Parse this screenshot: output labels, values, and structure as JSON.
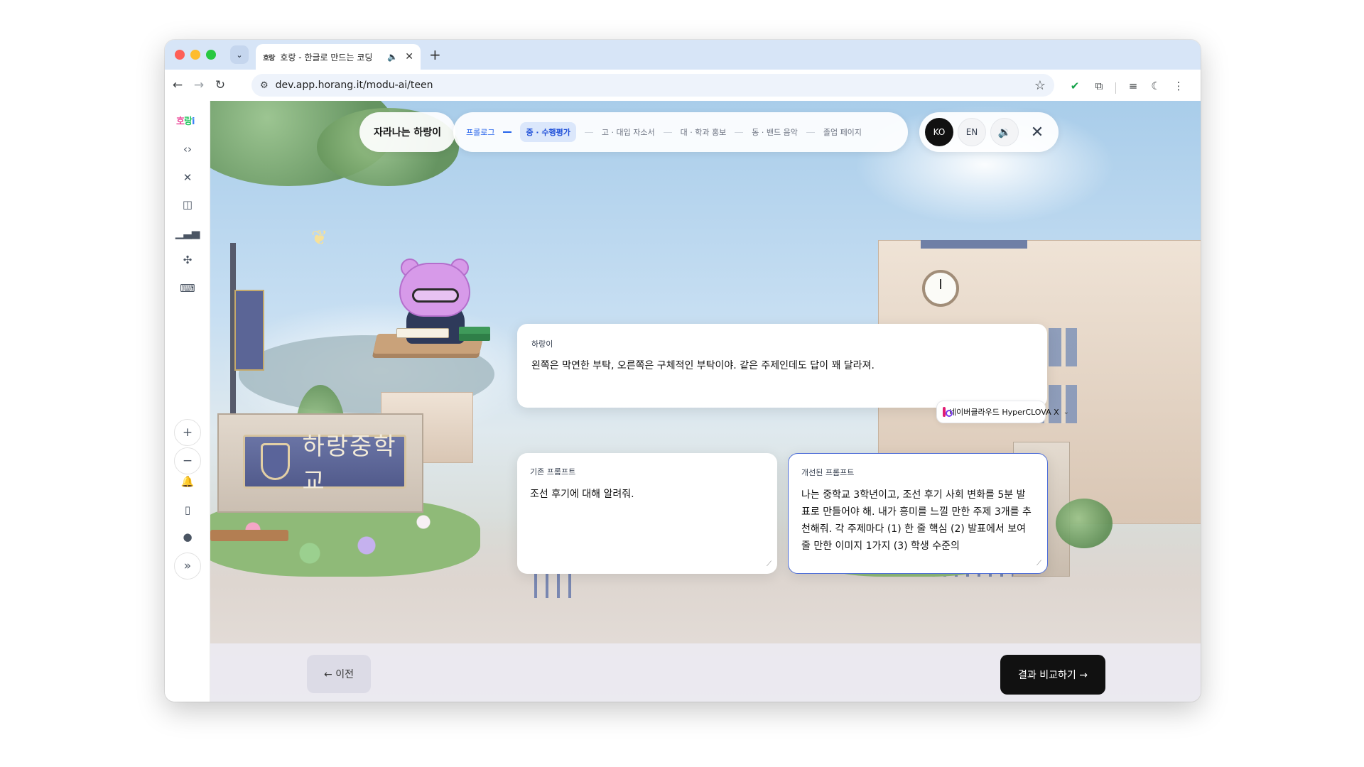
{
  "browser": {
    "tab": {
      "favicon": "호랑",
      "title": "호랑 - 한글로 만드는 코딩",
      "audio_icon": "speaker-icon",
      "close": "✕"
    },
    "new_tab": "+",
    "url": "dev.app.horang.it/modu-ai/teen"
  },
  "rail": {
    "logo": [
      "호",
      "랑",
      "i"
    ],
    "items": [
      "code-icon",
      "tools-icon",
      "box-icon",
      "chart-icon",
      "puzzle-icon",
      "keyboard-icon"
    ],
    "zoom_in": "+",
    "zoom_out": "−"
  },
  "header": {
    "title_chip": "자라나는 하랑이",
    "steps": [
      {
        "label": "프롤로그",
        "state": "done"
      },
      {
        "label": "중 · 수행평가",
        "state": "active"
      },
      {
        "label": "고 · 대입 자소서",
        "state": "todo"
      },
      {
        "label": "대 · 학과 홍보",
        "state": "todo"
      },
      {
        "label": "동 · 밴드 음악",
        "state": "todo"
      },
      {
        "label": "졸업 페이지",
        "state": "todo"
      }
    ],
    "lang_ko": "KO",
    "lang_en": "EN"
  },
  "scene": {
    "school_sign": "하랑중학교"
  },
  "speech": {
    "speaker": "하랑이",
    "text": "왼쪽은 막연한 부탁, 오른쪽은 구체적인 부탁이야. 같은 주제인데도 답이 꽤 달라져."
  },
  "model": {
    "name": "네이버클라우드 HyperCLOVA X"
  },
  "prompts": {
    "original_label": "기존 프롬프트",
    "original_text": "조선 후기에 대해 알려줘.",
    "improved_label": "개선된 프롬프트",
    "improved_text": "나는 중학교 3학년이고, 조선 후기 사회 변화를 5분 발표로 만들어야 해. 내가 흥미를 느낄 만한 주제 3개를 추천해줘. 각 주제마다 (1) 한 줄 핵심 (2) 발표에서 보여줄 만한 이미지 1가지 (3) 학생 수준의"
  },
  "footer": {
    "prev": "← 이전",
    "next": "결과 비교하기 →"
  },
  "colors": {
    "accent": "#2563eb",
    "primary_button": "#111111",
    "mascot": "#d79ae9"
  }
}
